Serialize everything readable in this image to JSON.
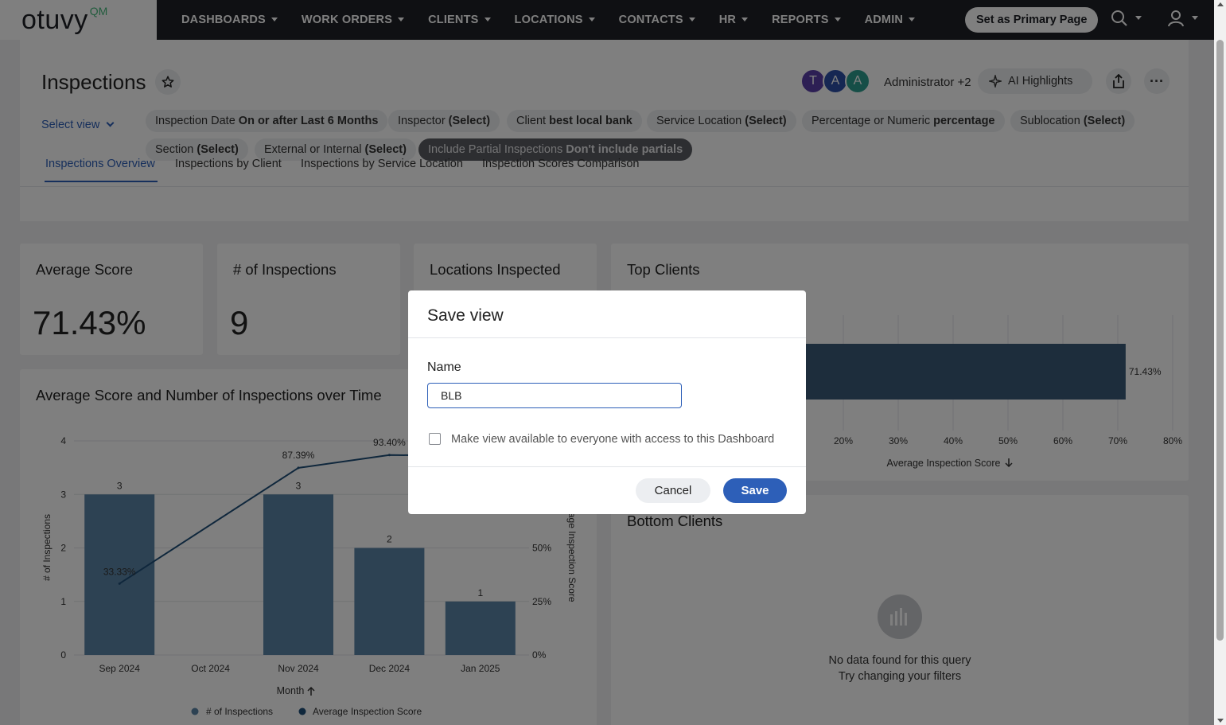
{
  "nav": {
    "logo_main": "otuvy",
    "logo_suffix": "QM",
    "items": [
      "DASHBOARDS",
      "WORK ORDERS",
      "CLIENTS",
      "LOCATIONS",
      "CONTACTS",
      "HR",
      "REPORTS",
      "ADMIN"
    ],
    "primary_button": "Set as Primary Page"
  },
  "header": {
    "title": "Inspections",
    "avatars": [
      {
        "letter": "T",
        "color": "#5b3fa8"
      },
      {
        "letter": "A",
        "color": "#2c4ea6"
      },
      {
        "letter": "A",
        "color": "#2d9c8f"
      }
    ],
    "admin_text": "Administrator +2",
    "ai_button": "AI Highlights",
    "select_view": "Select view"
  },
  "filters": [
    {
      "label": "Inspection Date",
      "value": "On or after Last 6 Months"
    },
    {
      "label": "Inspector",
      "value": "(Select)"
    },
    {
      "label": "Client",
      "value": "best local bank"
    },
    {
      "label": "Service Location",
      "value": "(Select)"
    },
    {
      "label": "Percentage or Numeric",
      "value": "percentage"
    },
    {
      "label": "Sublocation",
      "value": "(Select)"
    },
    {
      "label": "Section",
      "value": "(Select)"
    },
    {
      "label": "External or Internal",
      "value": "(Select)"
    },
    {
      "label": "Include Partial Inspections",
      "value": "Don't include partials"
    }
  ],
  "tabs": [
    "Inspections Overview",
    "Inspections by Client",
    "Inspections by Service Location",
    "Inspection Scores Comparison"
  ],
  "kpis": {
    "average_score_title": "Average Score",
    "average_score_value": "71.43%",
    "num_inspections_title": "# of Inspections",
    "num_inspections_value": "9",
    "locations_title": "Locations Inspected"
  },
  "top_clients": {
    "title": "Top Clients",
    "xlabel": "Average Inspection Score",
    "empty_title": "",
    "bottom_title": "Bottom Clients",
    "bottom_empty_1": "No data found for this query",
    "bottom_empty_2": "Try changing your filters"
  },
  "chart_data": [
    {
      "type": "bar",
      "title": "Average Score and Number of Inspections over Time",
      "categories": [
        "Sep 2024",
        "Oct 2024",
        "Nov 2024",
        "Dec 2024",
        "Jan 2025"
      ],
      "xlabel": "Month",
      "ylabel": "# of Inspections",
      "y2label": "Average Inspection Score",
      "ylim": [
        0,
        4
      ],
      "y2lim": [
        0,
        100
      ],
      "yticks": [
        "0",
        "1",
        "2",
        "3",
        "4"
      ],
      "y2ticks": [
        "0%",
        "25%",
        "50%"
      ],
      "series": [
        {
          "name": "# of Inspections",
          "type": "bar",
          "values": [
            3,
            0,
            3,
            2,
            1
          ],
          "labels": [
            "3",
            "",
            "3",
            "2",
            "1"
          ]
        },
        {
          "name": "Average Inspection Score",
          "type": "line",
          "values": [
            33.33,
            null,
            87.39,
            93.4,
            null
          ],
          "labels": [
            "33.33%",
            "",
            "87.39%",
            "93.40%",
            ""
          ]
        }
      ],
      "legend": [
        "# of Inspections",
        "Average Inspection Score"
      ]
    },
    {
      "type": "bar",
      "title": "Top Clients",
      "xlabel": "Average Inspection Score",
      "xticks": [
        "20%",
        "30%",
        "40%",
        "50%",
        "60%",
        "70%",
        "80%"
      ],
      "xlim": [
        0,
        80
      ],
      "values": [
        71.43
      ],
      "labels": [
        "71.43%"
      ]
    }
  ],
  "modal": {
    "title": "Save view",
    "name_label": "Name",
    "name_value": "BLB",
    "checkbox_label": "Make view available to everyone with access to this Dashboard",
    "cancel": "Cancel",
    "save": "Save"
  }
}
